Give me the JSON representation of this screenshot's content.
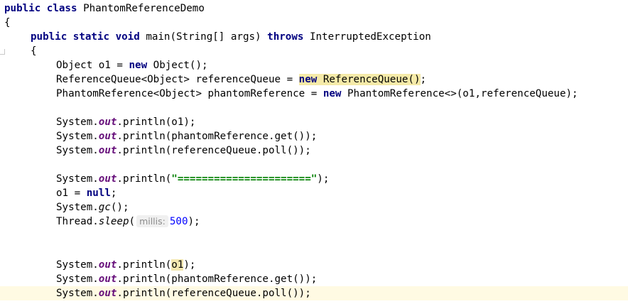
{
  "editor": {
    "class_header": {
      "kw_public": "public",
      "kw_class": "class",
      "class_name": "PhantomReferenceDemo"
    },
    "open_brace_outer": "{",
    "main_sig": {
      "kw_public": "public",
      "kw_static": "static",
      "kw_void": "void",
      "method": "main(String[] args) ",
      "kw_throws": "throws",
      "exception": " InterruptedException"
    },
    "open_brace_inner": "{",
    "line_o1": {
      "pre": "Object o1 = ",
      "kw_new": "new",
      "post": " Object();"
    },
    "line_queue": {
      "pre": "ReferenceQueue<Object> referenceQueue = ",
      "kw_new": "new",
      "post": " ReferenceQueue()",
      "end": ";"
    },
    "line_phantom": {
      "pre": "PhantomReference<Object> phantomReference = ",
      "kw_new": "new",
      "post": " PhantomReference<>(o1,referenceQueue);"
    },
    "print_o1": {
      "sys": "System.",
      "out": "out",
      "rest": ".println(o1);"
    },
    "print_get": {
      "sys": "System.",
      "out": "out",
      "rest": ".println(phantomReference.get());"
    },
    "print_poll": {
      "sys": "System.",
      "out": "out",
      "rest": ".println(referenceQueue.poll());"
    },
    "print_sep": {
      "sys": "System.",
      "out": "out",
      "pre": ".println(",
      "str": "\"======================\"",
      "post": ");"
    },
    "null_assign": {
      "pre": "o1 = ",
      "kw_null": "null",
      "post": ";"
    },
    "gc_call": {
      "sys": "System.",
      "method": "gc",
      "post": "();"
    },
    "sleep_call": {
      "pre": "Thread.",
      "method": "sleep",
      "paren": "(",
      "hint": "millis:",
      "num": "500",
      "post": ");"
    },
    "print_o1_b": {
      "sys": "System.",
      "out": "out",
      "pre": ".println(",
      "arg": "o1",
      "post": ");"
    },
    "print_get_b": {
      "sys": "System.",
      "out": "out",
      "rest": ".println(phantomReference.get());"
    },
    "print_poll_b": {
      "sys": "System.",
      "out": "out",
      "rest": ".println(referenceQueue.poll());"
    }
  },
  "colors": {
    "keyword": "#000080",
    "field": "#660e7a",
    "string": "#008000",
    "number": "#0000ff",
    "current_line": "#fffae3"
  }
}
